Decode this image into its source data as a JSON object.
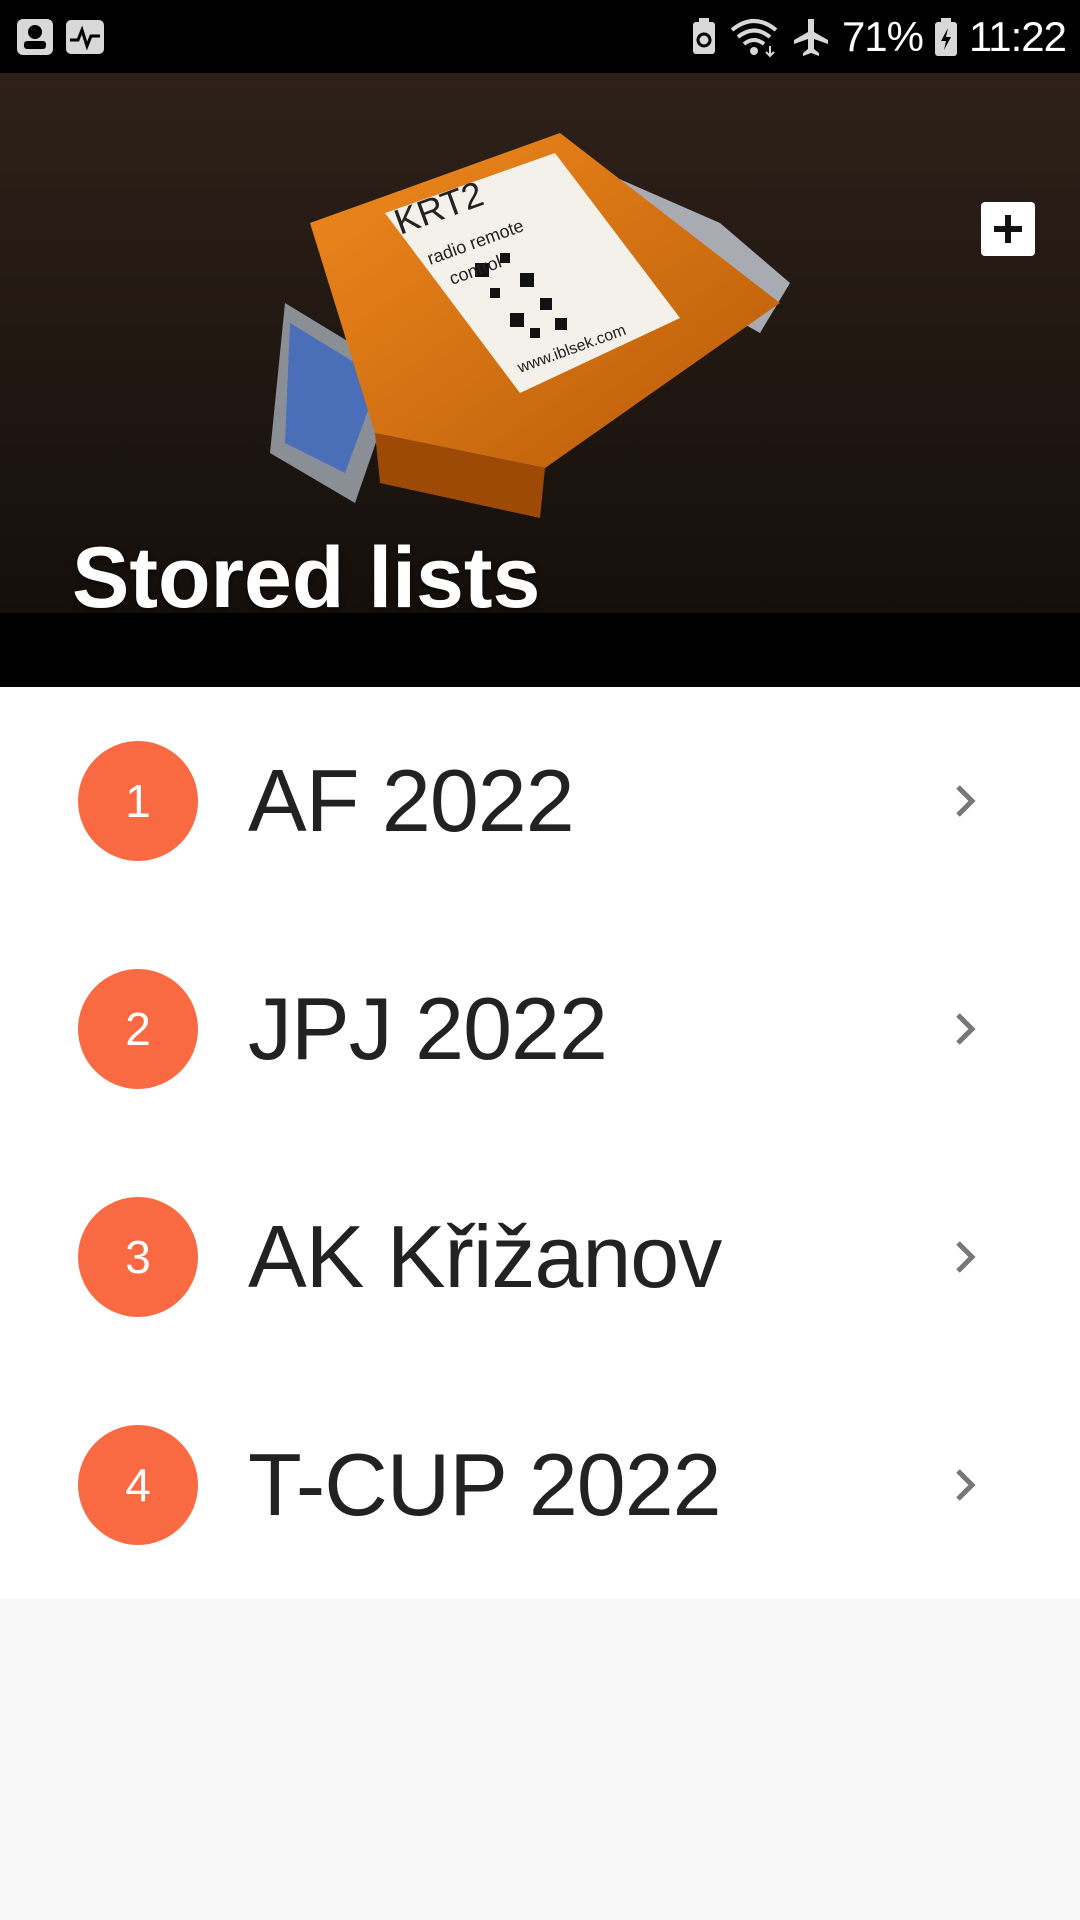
{
  "status_bar": {
    "battery_percent": "71%",
    "time": "11:22",
    "icons": [
      "vpn-icon",
      "activity-icon",
      "battery-saver-icon",
      "wifi-icon",
      "airplane-icon",
      "battery-charging-icon"
    ]
  },
  "header": {
    "title": "Stored lists",
    "add_icon": "plus-icon"
  },
  "hero_photo": {
    "label_brand": "KRT2",
    "label_line1": "radio remote",
    "label_line2": "control",
    "label_url": "www.iblsek.com"
  },
  "lists": [
    {
      "number": "1",
      "name": "AF 2022"
    },
    {
      "number": "2",
      "name": "JPJ 2022"
    },
    {
      "number": "3",
      "name": "AK Křižanov"
    },
    {
      "number": "4",
      "name": "T-CUP 2022"
    }
  ],
  "colors": {
    "accent": "#f96a42",
    "status_bar": "#000000",
    "background": "#f8f8f8"
  }
}
